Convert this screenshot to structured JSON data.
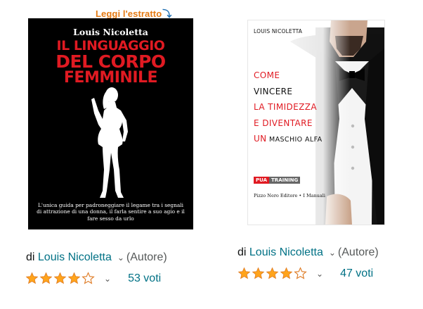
{
  "products": [
    {
      "read_sample_label": "Leggi l'estratto",
      "cover": {
        "author": "Louis Nicoletta",
        "title_line1": "Il linguaggio",
        "title_line2": "del corpo",
        "title_line3": "femminile",
        "blurb": "L'unica guida per padroneggiare il legame tra i segnali di attrazione di una donna, il farla sentire a suo agio e il fare sesso da urlo"
      },
      "byline": {
        "prefix": "di",
        "author": "Louis Nicoletta",
        "role": "(Autore)"
      },
      "rating": {
        "stars": 4,
        "out_of": 5,
        "count_label": "53 voti"
      }
    },
    {
      "cover": {
        "author": "LOUIS NICOLETTA",
        "title_lines": [
          "COME",
          "VINCERE",
          "LA TIMIDEZZA",
          "E DIVENTARE",
          "UN MASCHIO ALFA"
        ],
        "badge_left": "PUA",
        "badge_right": "TRAINING",
        "publisher": "Pizzo Nero Editore • I Manuali"
      },
      "byline": {
        "prefix": "di",
        "author": "Louis Nicoletta",
        "role": "(Autore)"
      },
      "rating": {
        "stars": 4,
        "out_of": 5,
        "count_label": "47 voti"
      }
    }
  ],
  "colors": {
    "link": "#007185",
    "star": "#ffa41c",
    "read_sample": "#e47911",
    "cover_red": "#e01a22"
  },
  "icons": {
    "chevron": "chevron-down-icon",
    "read_sample_arrow": "arrow-down-curved-icon",
    "star": "star-icon"
  }
}
